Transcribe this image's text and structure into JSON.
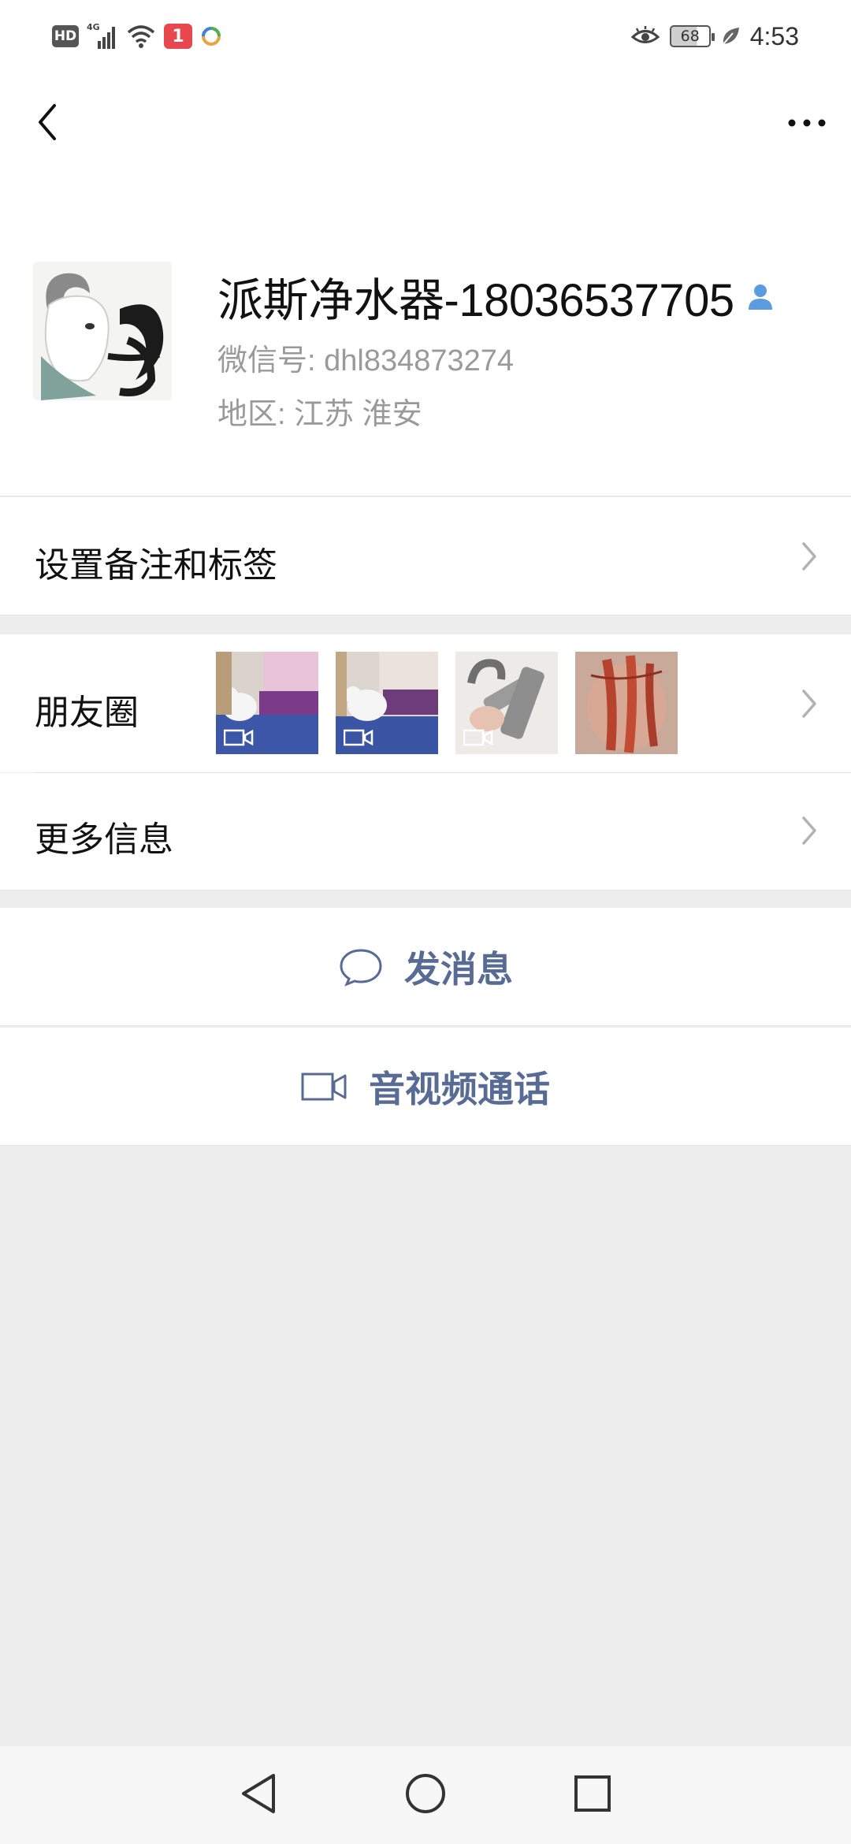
{
  "status_bar": {
    "hd": "HD",
    "network": "4G",
    "notification_count": "1",
    "battery": "68",
    "time": "4:53"
  },
  "profile": {
    "name": "派斯净水器-18036537705",
    "wechat_id": "微信号: dhl834873274",
    "region": "地区: 江苏  淮安"
  },
  "rows": {
    "remark_label": "设置备注和标签",
    "moments_label": "朋友圈",
    "more_info_label": "更多信息"
  },
  "actions": {
    "message_label": "发消息",
    "call_label": "音视频通话"
  },
  "colors": {
    "accent": "#576b95",
    "background": "#ededed",
    "verified": "#5b9be0"
  }
}
